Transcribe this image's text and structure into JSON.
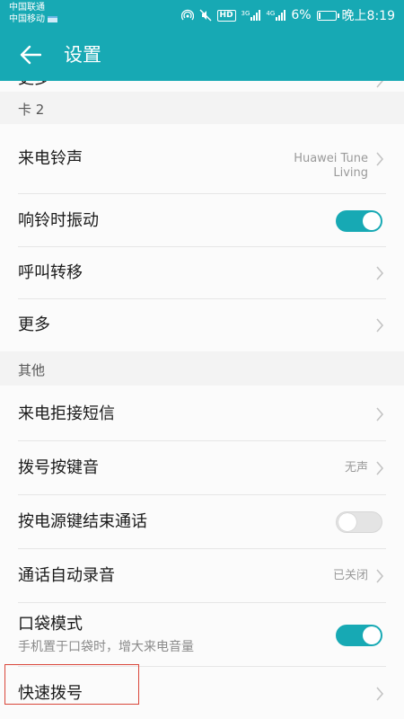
{
  "status_bar": {
    "carrier_1": "中国联通",
    "carrier_2": "中国移动",
    "hd_label": "HD",
    "net_1": "3G",
    "net_2": "4G",
    "battery_percent": "6%",
    "battery_level": 0.06,
    "time": "晚上8:19"
  },
  "app_bar": {
    "title": "设置"
  },
  "settings": {
    "partial_row_label": "更多",
    "card2_header": "卡 2",
    "ringtone_label": "来电铃声",
    "ringtone_value_line1": "Huawei Tune",
    "ringtone_value_line2": "Living",
    "vibrate_label": "响铃时振动",
    "vibrate_on": true,
    "forward_label": "呼叫转移",
    "more_label": "更多",
    "other_header": "其他",
    "reject_sms_label": "来电拒接短信",
    "dial_tone_label": "拨号按键音",
    "dial_tone_value": "无声",
    "power_end_label": "按电源键结束通话",
    "power_end_on": false,
    "auto_record_label": "通话自动录音",
    "auto_record_value": "已关闭",
    "pocket_label": "口袋模式",
    "pocket_sub": "手机置于口袋时，增大来电音量",
    "pocket_on": true,
    "speed_dial_label": "快速拨号"
  },
  "colors": {
    "accent": "#17a9b4",
    "highlight": "#d9463a"
  }
}
